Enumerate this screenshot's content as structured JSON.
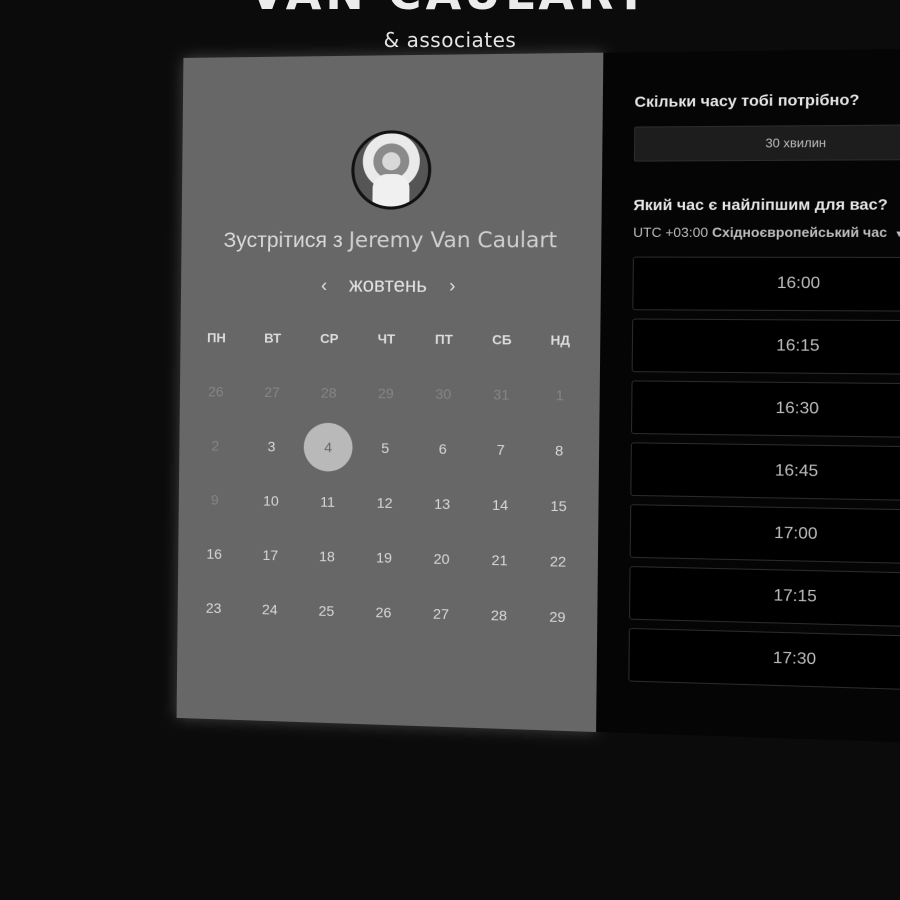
{
  "brand": {
    "name": "VAN CAULART",
    "sub": "& associates"
  },
  "calendar": {
    "title_prefix": "Зустрітися з",
    "host": "Jeremy Van Caulart",
    "month": "жовтень",
    "prev_arrow": "‹",
    "next_arrow": "›",
    "weekdays": [
      "ПН",
      "ВТ",
      "СР",
      "ЧТ",
      "ПТ",
      "СБ",
      "НД"
    ],
    "days": [
      {
        "n": "26",
        "muted": true
      },
      {
        "n": "27",
        "muted": true
      },
      {
        "n": "28",
        "muted": true
      },
      {
        "n": "29",
        "muted": true
      },
      {
        "n": "30",
        "muted": true
      },
      {
        "n": "31",
        "muted": true
      },
      {
        "n": "1",
        "muted": true
      },
      {
        "n": "2",
        "muted": true
      },
      {
        "n": "3"
      },
      {
        "n": "4",
        "selected": true
      },
      {
        "n": "5"
      },
      {
        "n": "6"
      },
      {
        "n": "7"
      },
      {
        "n": "8"
      },
      {
        "n": "9",
        "muted": true
      },
      {
        "n": "10"
      },
      {
        "n": "11"
      },
      {
        "n": "12"
      },
      {
        "n": "13"
      },
      {
        "n": "14"
      },
      {
        "n": "15"
      },
      {
        "n": "16"
      },
      {
        "n": "17"
      },
      {
        "n": "18"
      },
      {
        "n": "19"
      },
      {
        "n": "20"
      },
      {
        "n": "21"
      },
      {
        "n": "22"
      },
      {
        "n": "23"
      },
      {
        "n": "24"
      },
      {
        "n": "25"
      },
      {
        "n": "26"
      },
      {
        "n": "27"
      },
      {
        "n": "28"
      },
      {
        "n": "29"
      }
    ]
  },
  "booking": {
    "duration_question": "Скільки часу тобі потрібно?",
    "duration_value": "30 хвилин",
    "time_question": "Який час є найліпшим для вас?",
    "tz_offset": "UTC +03:00",
    "tz_name": "Східноєвропейський час",
    "slots": [
      "16:00",
      "16:15",
      "16:30",
      "16:45",
      "17:00",
      "17:15",
      "17:30"
    ]
  },
  "colors": {
    "background": "#0b0b0b",
    "calendar_panel": "#676767",
    "time_panel": "#050505",
    "selected_day": "#b9b9b9"
  }
}
